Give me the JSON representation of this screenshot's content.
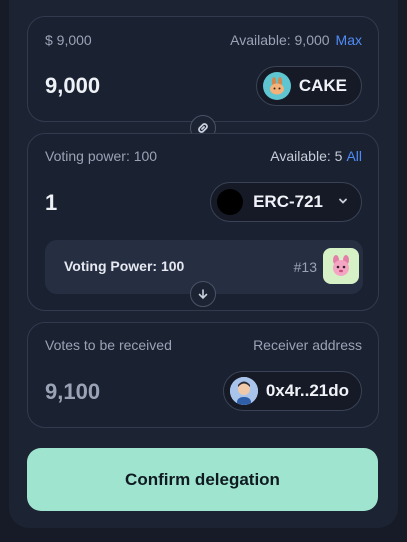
{
  "source": {
    "usd_value": "$ 9,000",
    "available_label": "Available: 9,000",
    "max_label": "Max",
    "amount": "9,000",
    "token": "CAKE"
  },
  "voting": {
    "power_label": "Voting power: 100",
    "available_label": "Available: 5",
    "all_label": "All",
    "amount": "1",
    "token": "ERC-721",
    "nft_card": {
      "label": "Voting Power: 100",
      "id": "#13"
    }
  },
  "receive": {
    "votes_label": "Votes to be received",
    "receiver_label": "Receiver address",
    "votes_value": "9,100",
    "address": "0x4r..21do"
  },
  "confirm_label": "Confirm delegation",
  "colors": {
    "accent": "#4f8cf7",
    "button": "#9fe4cf",
    "background": "#1c2333"
  }
}
